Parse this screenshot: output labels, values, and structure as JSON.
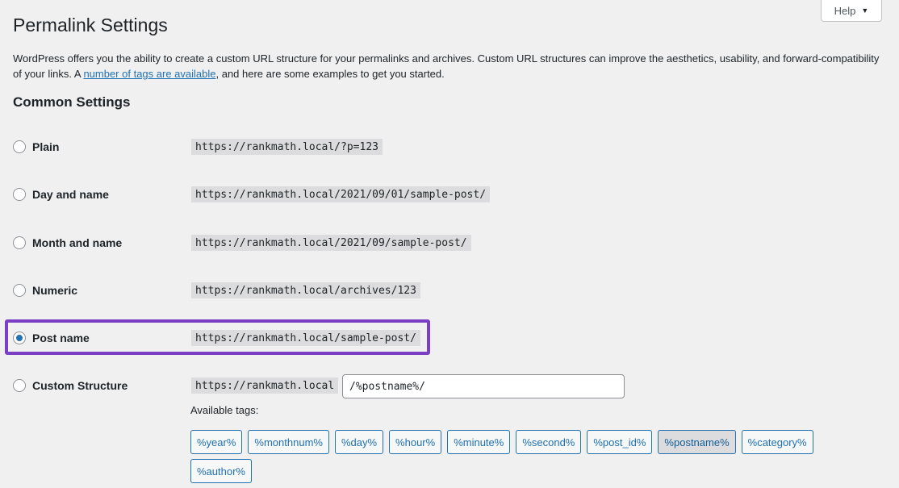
{
  "help": {
    "label": "Help",
    "caret": "▼"
  },
  "page_title": "Permalink Settings",
  "intro": {
    "before_link": "WordPress offers you the ability to create a custom URL structure for your permalinks and archives. Custom URL structures can improve the aesthetics, usability, and forward-compatibility of your links. A ",
    "link_text": "number of tags are available",
    "after_link": ", and here are some examples to get you started."
  },
  "common_settings_heading": "Common Settings",
  "options": [
    {
      "label": "Plain",
      "example": "https://rankmath.local/?p=123",
      "checked": false
    },
    {
      "label": "Day and name",
      "example": "https://rankmath.local/2021/09/01/sample-post/",
      "checked": false
    },
    {
      "label": "Month and name",
      "example": "https://rankmath.local/2021/09/sample-post/",
      "checked": false
    },
    {
      "label": "Numeric",
      "example": "https://rankmath.local/archives/123",
      "checked": false
    },
    {
      "label": "Post name",
      "example": "https://rankmath.local/sample-post/",
      "checked": true
    },
    {
      "label": "Custom Structure",
      "example": "https://rankmath.local",
      "checked": false
    }
  ],
  "custom_structure_value": "/%postname%/",
  "available_tags_label": "Available tags:",
  "tags": [
    {
      "label": "%year%",
      "active": false
    },
    {
      "label": "%monthnum%",
      "active": false
    },
    {
      "label": "%day%",
      "active": false
    },
    {
      "label": "%hour%",
      "active": false
    },
    {
      "label": "%minute%",
      "active": false
    },
    {
      "label": "%second%",
      "active": false
    },
    {
      "label": "%post_id%",
      "active": false
    },
    {
      "label": "%postname%",
      "active": true
    },
    {
      "label": "%category%",
      "active": false
    },
    {
      "label": "%author%",
      "active": false
    }
  ],
  "colors": {
    "highlight_border": "#7b3fc4",
    "link": "#2271b1",
    "background": "#f0f0f1"
  }
}
